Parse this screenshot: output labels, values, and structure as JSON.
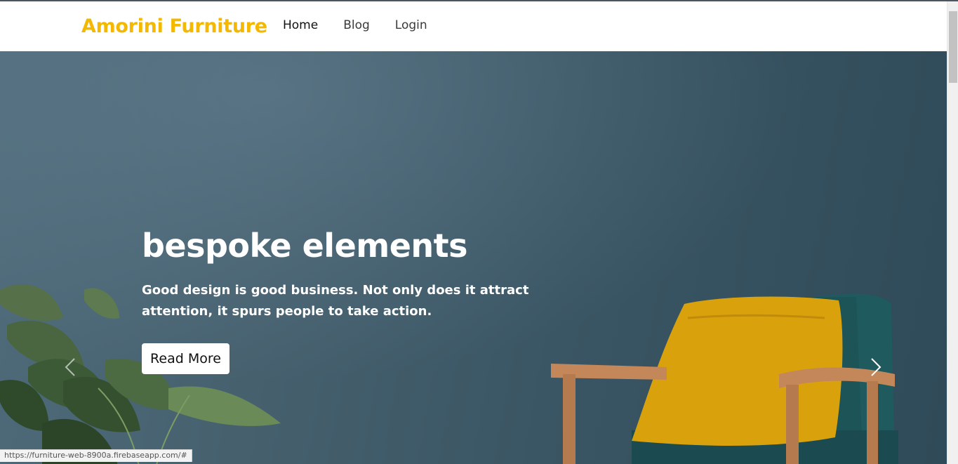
{
  "navbar": {
    "brand": "Amorini Furniture",
    "links": [
      "Home",
      "Blog",
      "Login"
    ]
  },
  "hero": {
    "title": "bespoke elements",
    "text": "Good design is good business. Not only does it attract attention, it spurs people to take action.",
    "button_label": "Read More",
    "prev_icon": "chevron-left-icon",
    "next_icon": "chevron-right-icon"
  },
  "status_bar": {
    "url": "https://furniture-web-8900a.firebaseapp.com/#"
  },
  "colors": {
    "brand": "#f5b800",
    "hero_bg": "#3f5a69",
    "pillow": "#d9a20d",
    "chair_fabric": "#1f5a5e"
  }
}
